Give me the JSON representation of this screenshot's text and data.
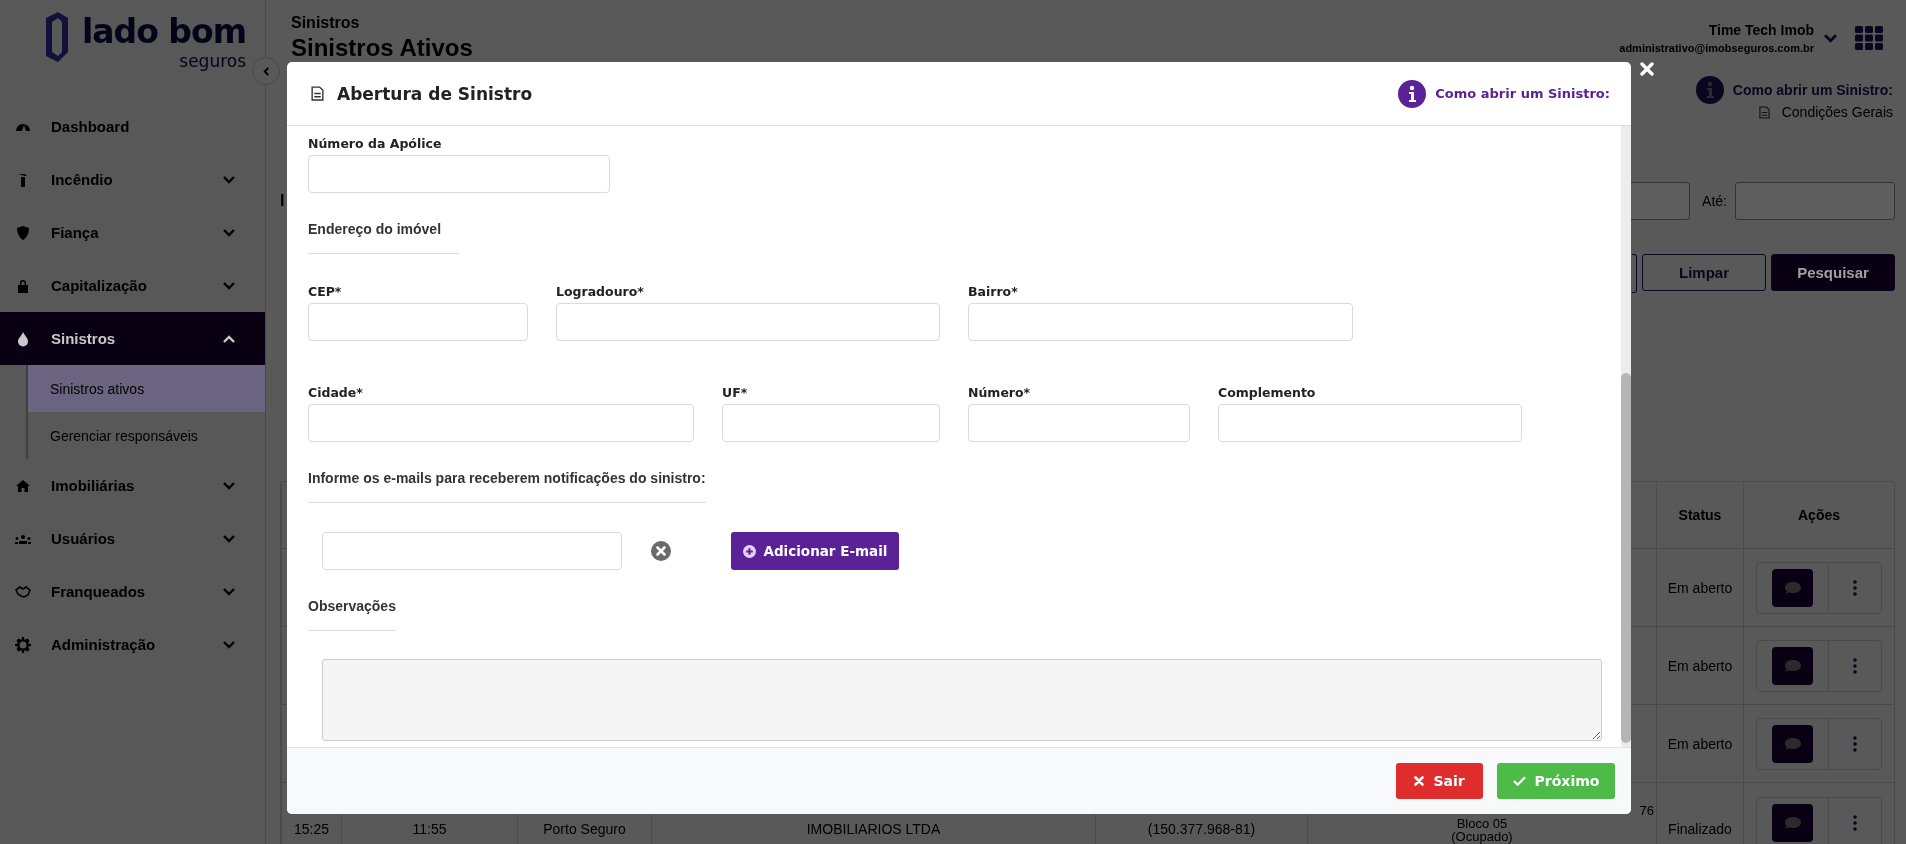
{
  "sidebar": {
    "logo": {
      "wordmark": "lado bom",
      "tagline": "seguros"
    },
    "items": [
      {
        "label": "Dashboard",
        "has_submenu": false,
        "selected": false
      },
      {
        "label": "Incêndio",
        "has_submenu": true,
        "expanded": false,
        "selected": false
      },
      {
        "label": "Fiança",
        "has_submenu": true,
        "expanded": false,
        "selected": false
      },
      {
        "label": "Capitalização",
        "has_submenu": true,
        "expanded": false,
        "selected": false
      },
      {
        "label": "Sinistros",
        "has_submenu": true,
        "expanded": true,
        "selected": true,
        "children": [
          {
            "label": "Sinistros ativos",
            "selected": true
          },
          {
            "label": "Gerenciar responsáveis",
            "selected": false
          }
        ]
      },
      {
        "label": "Imobiliárias",
        "has_submenu": true,
        "expanded": false,
        "selected": false
      },
      {
        "label": "Usuários",
        "has_submenu": true,
        "expanded": false,
        "selected": false
      },
      {
        "label": "Franqueados",
        "has_submenu": true,
        "expanded": false,
        "selected": false
      },
      {
        "label": "Administração",
        "has_submenu": true,
        "expanded": false,
        "selected": false
      }
    ]
  },
  "page": {
    "breadcrumb": "Sinistros",
    "title": "Sinistros Ativos"
  },
  "user": {
    "name": "Time Tech Imob",
    "email": "administrativo@imobseguros.com.br"
  },
  "help": {
    "link": "Como abrir um Sinistro:",
    "document": "Condições Gerais"
  },
  "filters": {
    "label": "I",
    "date_to_label": "Até:"
  },
  "filter_buttons": [
    {
      "label": "Limpar",
      "kind": "outline"
    },
    {
      "label": "Pesquisar",
      "kind": "solid"
    }
  ],
  "table": {
    "columns": [
      "Status",
      "Ações"
    ],
    "rows": [
      {
        "status": "Em aberto"
      },
      {
        "status": "Em aberto"
      },
      {
        "status": "Em aberto"
      },
      {
        "status": "Finalizado",
        "cells": [
          "15:25",
          "11:55",
          "Porto Seguro",
          "IMOBILIARIOS LTDA",
          "(150.377.968-81)"
        ],
        "address_lines": [
          "76",
          "Bloco 05",
          "(Ocupado)"
        ]
      }
    ]
  },
  "modal": {
    "title": "Abertura de Sinistro",
    "help_link": "Como abrir um Sinistro:",
    "policy_field": {
      "label": "Número da Apólice"
    },
    "address": {
      "heading": "Endereço do imóvel",
      "rows": [
        [
          {
            "label": "CEP*"
          },
          {
            "label": "Logradouro*"
          },
          {
            "label": "Bairro*"
          }
        ],
        [
          {
            "label": "Cidade*"
          },
          {
            "label": "UF*"
          },
          {
            "label": "Número*"
          },
          {
            "label": "Complemento"
          }
        ]
      ]
    },
    "emails": {
      "heading": "Informe os e-mails para receberem notificações do sinistro:",
      "entries": [
        {
          "removable": true
        }
      ],
      "add_button": "Adicionar E-mail"
    },
    "notes": {
      "heading": "Observações"
    },
    "footer_buttons": [
      {
        "label": "Sair",
        "kind": "danger"
      },
      {
        "label": "Próximo",
        "kind": "success"
      }
    ]
  }
}
